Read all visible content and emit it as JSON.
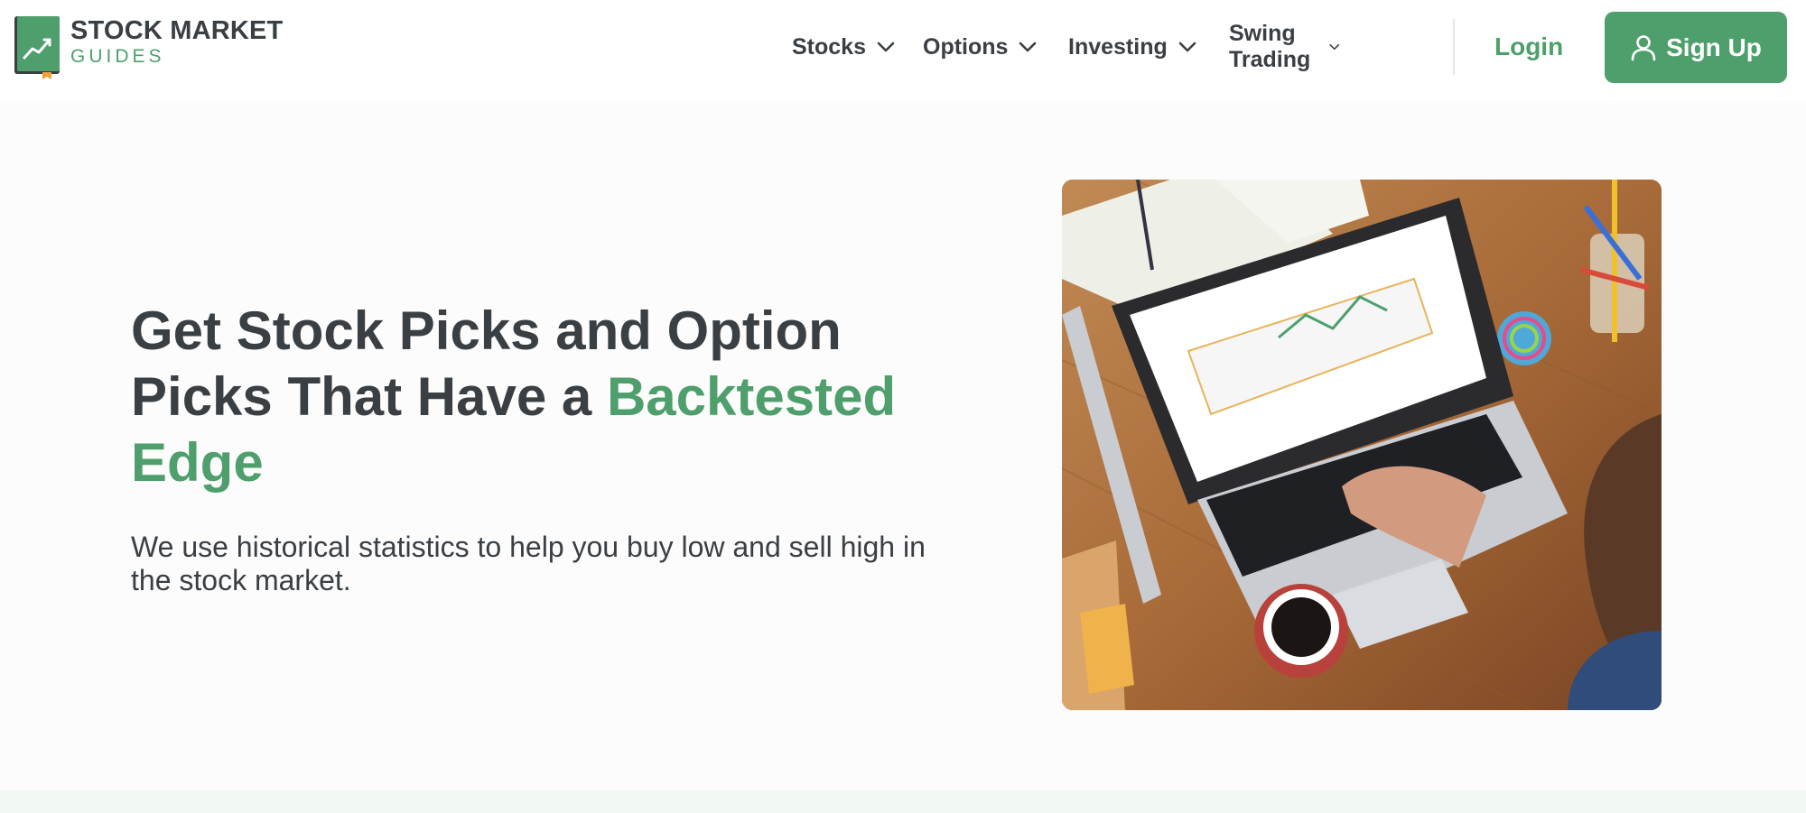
{
  "logo": {
    "line1": "STOCK MARKET",
    "line2": "GUIDES",
    "brand_color": "#4e9f6c",
    "icon": "chart-book-logo-icon"
  },
  "nav": {
    "items": [
      {
        "label": "Stocks",
        "icon": "chevron-down-icon"
      },
      {
        "label": "Options",
        "icon": "chevron-down-icon"
      },
      {
        "label": "Investing",
        "icon": "chevron-down-icon"
      },
      {
        "label": "Swing Trading",
        "icon": "chevron-down-icon"
      }
    ],
    "login_label": "Login",
    "signup_label": "Sign Up",
    "signup_icon": "user-icon"
  },
  "hero": {
    "title_part1": "Get Stock Picks and Option Picks That Have a ",
    "title_accent": "Backtested Edge",
    "subtitle": "We use historical statistics to help you buy low and sell high in the stock market.",
    "image_icon": "laptop-on-desk-photo",
    "accent_color": "#4e9f6c",
    "text_color": "#3a3f44"
  }
}
